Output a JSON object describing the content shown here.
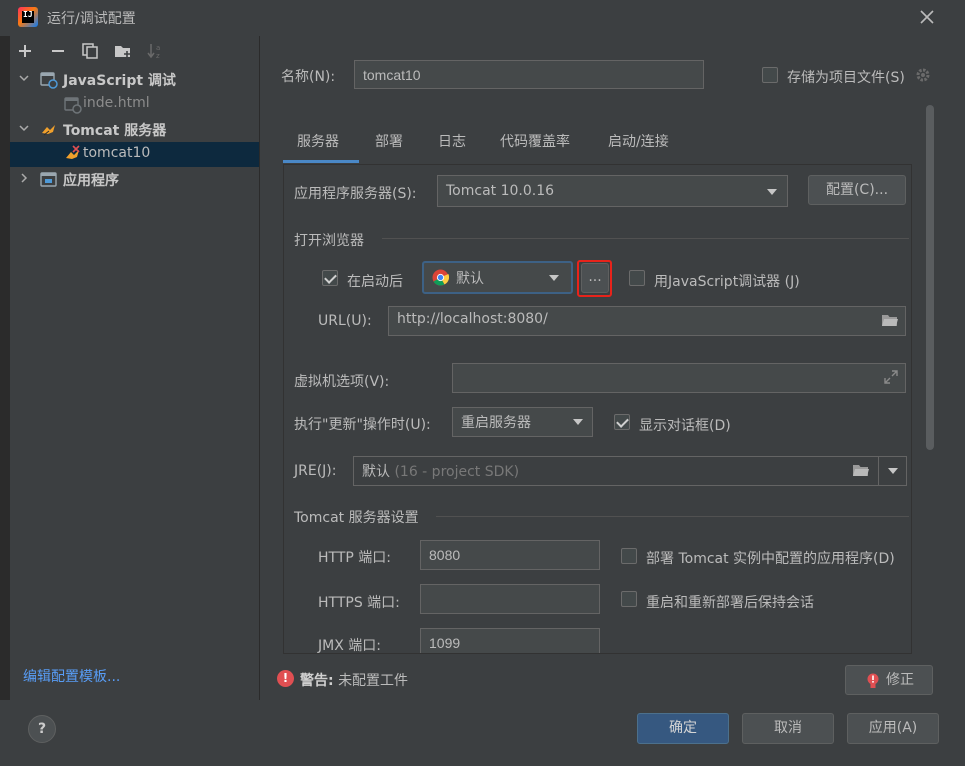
{
  "window": {
    "title": "运行/调试配置",
    "close_icon": "close-icon"
  },
  "sidebar": {
    "toolbar": [
      "add-icon",
      "remove-icon",
      "copy-icon",
      "new-folder-icon",
      "sort-icon"
    ],
    "tree": [
      {
        "label": "JavaScript 调试",
        "level": 0,
        "expanded": true,
        "bold": true,
        "icon": "javascript-debug-icon"
      },
      {
        "label": "inde.html",
        "level": 1,
        "dim": true,
        "icon": "html-config-icon"
      },
      {
        "label": "Tomcat 服务器",
        "level": 0,
        "expanded": true,
        "bold": true,
        "icon": "tomcat-icon"
      },
      {
        "label": "tomcat10",
        "level": 1,
        "selected": true,
        "icon": "tomcat-error-icon"
      },
      {
        "label": "应用程序",
        "level": 0,
        "expanded": false,
        "bold": true,
        "icon": "application-icon"
      }
    ],
    "edit_templates": "编辑配置模板..."
  },
  "form": {
    "name_label": "名称(N):",
    "name_value": "tomcat10",
    "store_label": "存储为项目文件(S)",
    "tabs": [
      "服务器",
      "部署",
      "日志",
      "代码覆盖率",
      "启动/连接"
    ],
    "active_tab": 0,
    "app_server_label": "应用程序服务器(S):",
    "app_server_value": "Tomcat 10.0.16",
    "configure_btn": "配置(C)...",
    "open_browser_section": "打开浏览器",
    "after_launch_label": "在启动后",
    "browser_value": "默认",
    "ellipsis_btn": "...",
    "js_debugger_label": "用JavaScript调试器 (J)",
    "url_label": "URL(U):",
    "url_value": "http://localhost:8080/",
    "vm_options_label": "虚拟机选项(V):",
    "on_update_label": "执行\"更新\"操作时(U):",
    "on_update_value": "重启服务器",
    "show_dialog_label": "显示对话框(D)",
    "jre_label": "JRE(J):",
    "jre_value": "默认",
    "jre_hint": "(16 - project SDK)",
    "tomcat_section": "Tomcat 服务器设置",
    "http_port_label": "HTTP 端口:",
    "http_port_value": "8080",
    "https_port_label": "HTTPS 端口:",
    "https_port_value": "",
    "jmx_port_label": "JMX 端口:",
    "jmx_port_value": "1099",
    "deploy_apps_label": "部署 Tomcat 实例中配置的应用程序(D)",
    "preserve_sessions_label": "重启和重新部署后保持会话"
  },
  "warning": {
    "bold": "警告:",
    "text": "未配置工件",
    "fix_btn": "修正"
  },
  "buttons": {
    "ok": "确定",
    "cancel": "取消",
    "apply": "应用(A)",
    "help": "?"
  },
  "colors": {
    "accent": "#4a88c7",
    "primary_button": "#365880",
    "error": "#e04f52",
    "highlight_box": "#e8231b",
    "link": "#589df6"
  }
}
